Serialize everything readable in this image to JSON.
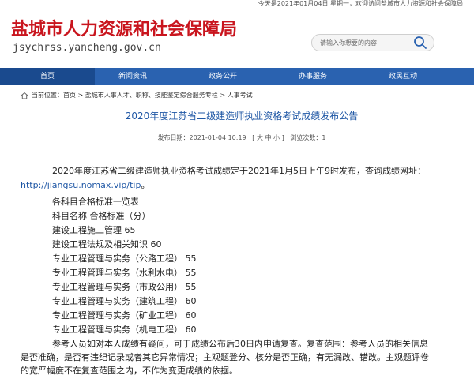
{
  "topbar": {
    "date_text": "今天是2021年01月04日 星期一，欢迎访问盐城市人力资源和社会保障局"
  },
  "header": {
    "logo_cn": "盐城市人力资源和社会保障局",
    "logo_url": "jsychrss.yancheng.gov.cn",
    "search_placeholder": "请输入你想要的内容",
    "search_icon": "search-icon"
  },
  "nav": {
    "items": [
      {
        "label": "首页",
        "active": true
      },
      {
        "label": "新闻资讯"
      },
      {
        "label": "政务公开"
      },
      {
        "label": "办事服务"
      },
      {
        "label": "政民互动"
      }
    ]
  },
  "breadcrumb": {
    "text": "当前位置：首页 > 盐城市人事人才、职称、技能鉴定综合服务专栏 > 人事考试"
  },
  "article": {
    "title": "2020年度江苏省二级建造师执业资格考试成绩发布公告",
    "meta": "发布日期：2021-01-04 10:19   [ 大 中 小 ]   浏览次数：1",
    "intro_text": "2020年度江苏省二级建造师执业资格考试成绩定于2021年1月5日上午9时发布，查询成绩网址：",
    "intro_link": "http://jiangsu.nomax.vip/tip",
    "intro_end": "。",
    "lines": [
      "各科目合格标准一览表",
      "科目名称 合格标准（分）",
      "建设工程施工管理 65",
      "建设工程法规及相关知识 60",
      "专业工程管理与实务（公路工程） 55",
      "专业工程管理与实务（水利水电） 55",
      "专业工程管理与实务（市政公用） 55",
      "专业工程管理与实务（建筑工程） 60",
      "专业工程管理与实务（矿业工程） 60",
      "专业工程管理与实务（机电工程） 60"
    ],
    "closing": "参考人员如对本人成绩有疑问，可于成绩公布后30日内申请复查。复查范围：参考人员的相关信息是否准确，是否有违纪记录或者其它异常情况；主观题登分、核分是否正确，有无漏改、错改。主观题评卷的宽严幅度不在复查范围之内，不作为变更成绩的依据。"
  },
  "colors": {
    "brand_red": "#c9151e",
    "nav_blue": "#2a62b0",
    "title_blue": "#1f57a5"
  }
}
